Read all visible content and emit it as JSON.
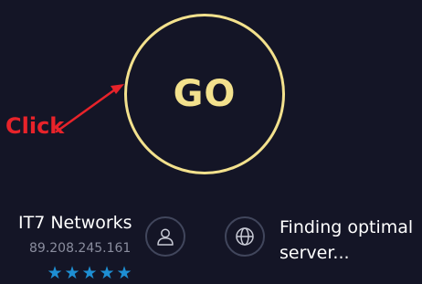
{
  "go_button": {
    "label": "GO"
  },
  "annotation": {
    "text": "Click",
    "color": "#e8232a"
  },
  "provider": {
    "name": "IT7 Networks",
    "ip": "89.208.245.161",
    "rating_stars": 5
  },
  "server": {
    "status_line1": "Finding optimal",
    "status_line2": "server..."
  },
  "icons": {
    "provider": "user-icon",
    "server": "globe-icon"
  },
  "colors": {
    "background": "#141526",
    "go_ring": "#f3e18d",
    "star": "#1e8fd3",
    "icon_ring": "#41465c"
  }
}
